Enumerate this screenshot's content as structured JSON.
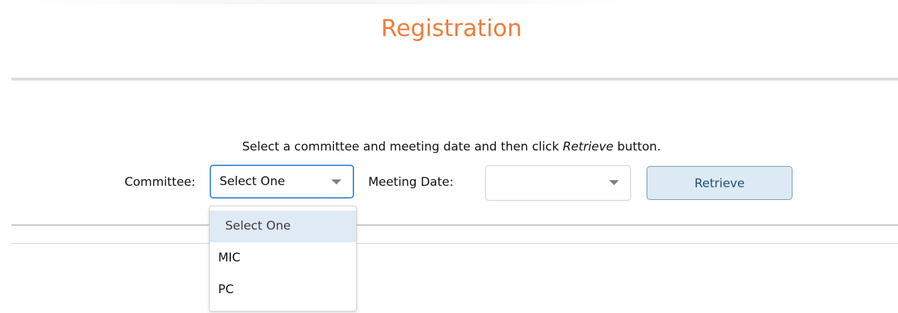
{
  "page": {
    "title": "Registration"
  },
  "instructions": {
    "before": "Select a committee and meeting date and then click ",
    "emphasis": "Retrieve",
    "after": " button."
  },
  "form": {
    "committee_label": "Committee:",
    "committee_value": "Select One",
    "meeting_date_label": "Meeting Date:",
    "meeting_date_value": "",
    "retrieve_label": "Retrieve"
  },
  "committee_dropdown": {
    "options": [
      "Select One",
      "MIC",
      "PC"
    ],
    "highlighted": "Select One"
  },
  "colors": {
    "title": "#ee7d3b",
    "focus_border": "#4a90d9",
    "button_bg": "#dde9f3",
    "highlight_bg": "#dfeaf5"
  },
  "icons": {
    "committee_caret": "caret-down-icon",
    "meeting_caret": "caret-down-icon"
  }
}
